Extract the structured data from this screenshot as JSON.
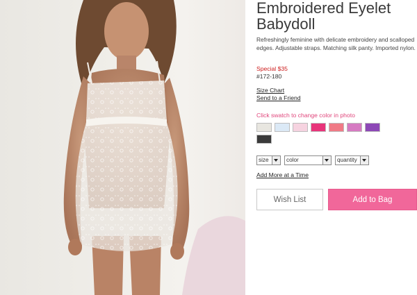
{
  "product": {
    "title": "Embroidered Eyelet Babydoll",
    "description": "Refreshingly feminine with delicate embroidery and scalloped edges. Adjustable straps. Matching silk panty. Imported nylon.",
    "price": "Special $35",
    "sku": "#172-180"
  },
  "links": {
    "size_chart": "Size Chart",
    "send_friend": "Send to a Friend",
    "add_more": "Add More at a Time"
  },
  "swatch_hint": "Click swatch to change color in photo",
  "swatches": [
    {
      "name": "ivory",
      "color": "#e8e6e0"
    },
    {
      "name": "light-blue",
      "color": "#dbe9f6"
    },
    {
      "name": "light-pink",
      "color": "#f6d3e0"
    },
    {
      "name": "hot-pink",
      "color": "#e8347a"
    },
    {
      "name": "coral",
      "color": "#f07a86"
    },
    {
      "name": "pink-lavender",
      "color": "#d67ac2"
    },
    {
      "name": "purple",
      "color": "#8d48b6"
    },
    {
      "name": "black",
      "color": "#3a3a3a"
    }
  ],
  "selects": {
    "size": "size",
    "color": "color",
    "quantity": "quantity"
  },
  "buttons": {
    "wish_list": "Wish List",
    "add_to_bag": "Add to Bag"
  },
  "colors": {
    "accent_pink": "#f1679a",
    "price_red": "#cc1b1b",
    "hint_pink": "#e0457b"
  }
}
